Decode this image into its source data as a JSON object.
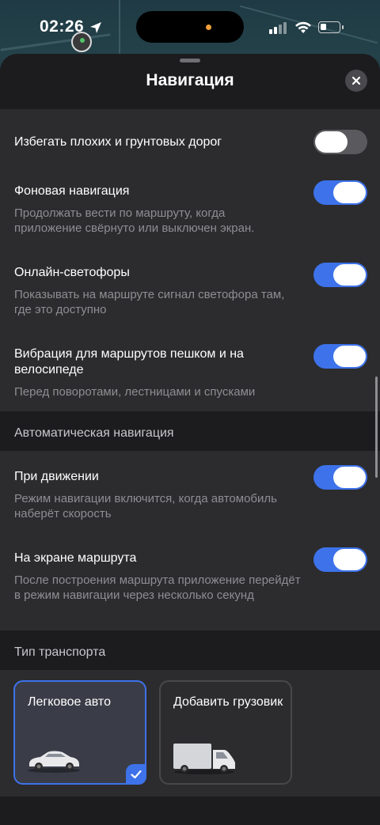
{
  "status_bar": {
    "time": "02:26"
  },
  "sheet": {
    "title": "Навигация"
  },
  "settings": [
    {
      "title": "Избегать плохих и грунтовых дорог",
      "description": "",
      "enabled": false
    },
    {
      "title": "Фоновая навигация",
      "description": "Продолжать вести по маршруту, когда приложение свёрнуто или выключен экран.",
      "enabled": true
    },
    {
      "title": "Онлайн-светофоры",
      "description": "Показывать на маршруте сигнал светофора там, где это доступно",
      "enabled": true
    },
    {
      "title": "Вибрация для маршрутов пешком и на велосипеде",
      "description": "Перед поворотами, лестницами и спусками",
      "enabled": true
    }
  ],
  "auto_navigation": {
    "header": "Автоматическая навигация",
    "items": [
      {
        "title": "При движении",
        "description": "Режим навигации включится, когда автомобиль наберёт скорость",
        "enabled": true
      },
      {
        "title": "На экране маршрута",
        "description": "После построения маршрута приложение перейдёт в режим навигации через несколько секунд",
        "enabled": true
      }
    ]
  },
  "transport": {
    "header": "Тип транспорта",
    "options": [
      {
        "label": "Легковое авто",
        "selected": true,
        "icon": "car-icon"
      },
      {
        "label": "Добавить грузовик",
        "selected": false,
        "icon": "truck-icon"
      }
    ]
  },
  "colors": {
    "accent": "#3d72ea",
    "sheet_bg": "#1c1c1e",
    "card_bg": "#2c2c2e",
    "secondary_text": "#8e8e93"
  }
}
